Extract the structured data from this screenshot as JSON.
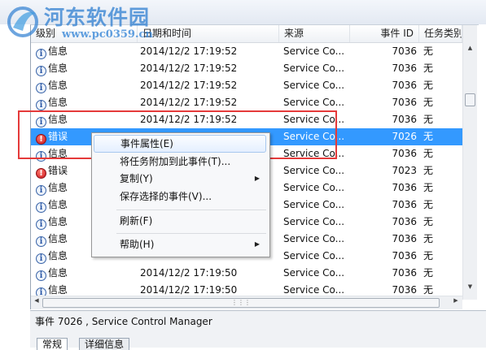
{
  "columns": [
    "级别",
    "日期和时间",
    "来源",
    "事件 ID",
    "任务类别"
  ],
  "rows": [
    {
      "level": "信息",
      "type": "info",
      "date": "2014/12/2 17:19:52",
      "source": "Service Co...",
      "id": "7036",
      "cat": "无"
    },
    {
      "level": "信息",
      "type": "info",
      "date": "2014/12/2 17:19:52",
      "source": "Service Co...",
      "id": "7036",
      "cat": "无"
    },
    {
      "level": "信息",
      "type": "info",
      "date": "2014/12/2 17:19:52",
      "source": "Service Co...",
      "id": "7036",
      "cat": "无"
    },
    {
      "level": "信息",
      "type": "info",
      "date": "2014/12/2 17:19:52",
      "source": "Service Co...",
      "id": "7036",
      "cat": "无"
    },
    {
      "level": "信息",
      "type": "info",
      "date": "2014/12/2 17:19:52",
      "source": "Service Co...",
      "id": "7036",
      "cat": "无"
    },
    {
      "level": "错误",
      "type": "err",
      "date": "",
      "source": "Service Co...",
      "id": "7026",
      "cat": "无",
      "selected": true
    },
    {
      "level": "信息",
      "type": "info",
      "date": "",
      "source": "Service Co...",
      "id": "7036",
      "cat": "无"
    },
    {
      "level": "错误",
      "type": "err",
      "date": "",
      "source": "Service Co...",
      "id": "7023",
      "cat": "无"
    },
    {
      "level": "信息",
      "type": "info",
      "date": "",
      "source": "Service Co...",
      "id": "7036",
      "cat": "无"
    },
    {
      "level": "信息",
      "type": "info",
      "date": "",
      "source": "Service Co...",
      "id": "7036",
      "cat": "无"
    },
    {
      "level": "信息",
      "type": "info",
      "date": "",
      "source": "Service Co...",
      "id": "7036",
      "cat": "无"
    },
    {
      "level": "信息",
      "type": "info",
      "date": "",
      "source": "Service Co...",
      "id": "7036",
      "cat": "无"
    },
    {
      "level": "信息",
      "type": "info",
      "date": "",
      "source": "Service Co...",
      "id": "7036",
      "cat": "无"
    },
    {
      "level": "信息",
      "type": "info",
      "date": "2014/12/2 17:19:50",
      "source": "Service Co...",
      "id": "7036",
      "cat": "无"
    },
    {
      "level": "信息",
      "type": "info",
      "date": "2014/12/2 17:19:50",
      "source": "Service Co...",
      "id": "7036",
      "cat": "无"
    }
  ],
  "context_menu": [
    {
      "label": "事件属性(E)",
      "highlight": true
    },
    {
      "label": "将任务附加到此事件(T)..."
    },
    {
      "label": "复制(Y)",
      "submenu": true
    },
    {
      "label": "保存选择的事件(V)..."
    },
    {
      "label": "刷新(F)"
    },
    {
      "label": "帮助(H)",
      "submenu": true
    }
  ],
  "detail": {
    "title": "事件 7026 , Service Control Manager",
    "tabs": [
      "常规",
      "详细信息"
    ]
  },
  "watermark": {
    "name": "河东软件园",
    "url": "www.pc0359.cn"
  },
  "icons": {
    "info": "info-icon",
    "error": "error-icon"
  },
  "colors": {
    "selection": "#3399ff",
    "highlight_box": "#e53a3a"
  }
}
